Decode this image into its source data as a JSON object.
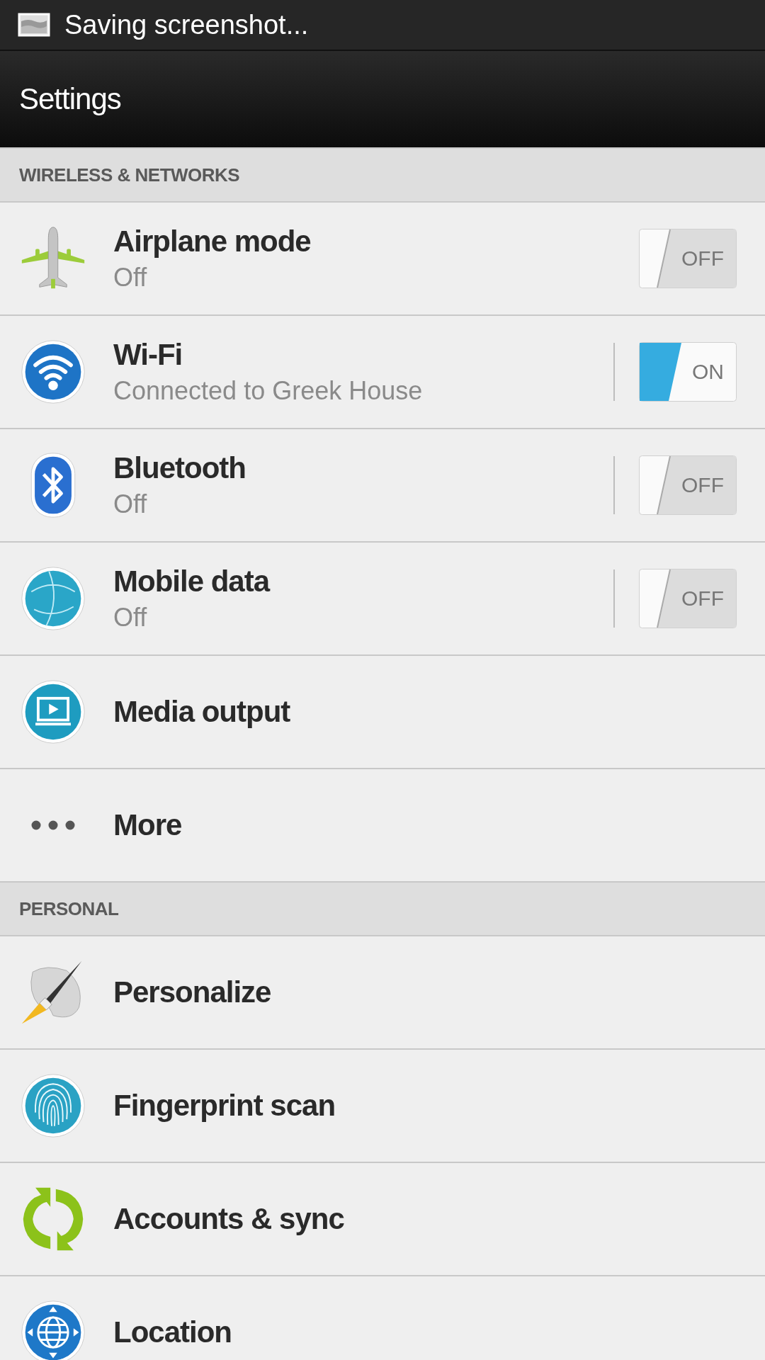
{
  "notification": {
    "text": "Saving screenshot..."
  },
  "title": "Settings",
  "sections": [
    {
      "header": "WIRELESS & NETWORKS",
      "items": [
        {
          "kind": "airplane",
          "label": "Airplane mode",
          "summary": "Off",
          "toggle": {
            "on": false,
            "label": "OFF",
            "divider": false
          }
        },
        {
          "kind": "wifi",
          "label": "Wi-Fi",
          "summary": "Connected to Greek House",
          "toggle": {
            "on": true,
            "label": "ON",
            "divider": true
          }
        },
        {
          "kind": "bluetooth",
          "label": "Bluetooth",
          "summary": "Off",
          "toggle": {
            "on": false,
            "label": "OFF",
            "divider": true
          }
        },
        {
          "kind": "mobile_data",
          "label": "Mobile data",
          "summary": "Off",
          "toggle": {
            "on": false,
            "label": "OFF",
            "divider": true
          }
        },
        {
          "kind": "media",
          "label": "Media output"
        },
        {
          "kind": "more",
          "label": "More"
        }
      ]
    },
    {
      "header": "PERSONAL",
      "items": [
        {
          "kind": "personalize",
          "label": "Personalize"
        },
        {
          "kind": "fingerprint",
          "label": "Fingerprint scan"
        },
        {
          "kind": "sync",
          "label": "Accounts & sync"
        },
        {
          "kind": "location",
          "label": "Location"
        }
      ]
    }
  ]
}
